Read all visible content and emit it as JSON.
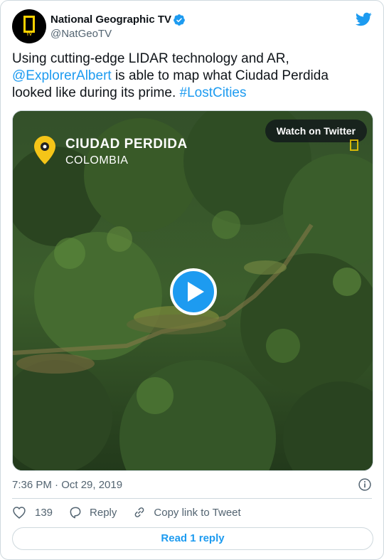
{
  "account": {
    "display_name": "National Geographic TV",
    "handle": "@NatGeoTV",
    "avatar_label": "TV",
    "verified": true
  },
  "tweet": {
    "text_before": "Using cutting-edge LIDAR technology and AR, ",
    "mention": "@ExplorerAlbert",
    "text_middle": " is able to map what Ciudad Perdida looked like during its prime. ",
    "hashtag": "#LostCities"
  },
  "media": {
    "location_title": "CIUDAD PERDIDA",
    "location_subtitle": "COLOMBIA",
    "watch_label": "Watch on Twitter"
  },
  "meta": {
    "timestamp": "7:36 PM · Oct 29, 2019"
  },
  "actions": {
    "like_count": "139",
    "reply_label": "Reply",
    "copy_label": "Copy link to Tweet"
  },
  "footer": {
    "read_replies_label": "Read 1 reply"
  },
  "colors": {
    "accent": "#1d9bf0",
    "brand_yellow": "#ffd200",
    "muted_text": "#536471"
  },
  "icons": [
    "verified-badge-icon",
    "twitter-bird-icon",
    "location-pin-icon",
    "play-icon",
    "info-icon",
    "heart-icon",
    "reply-bubble-icon",
    "link-icon"
  ]
}
